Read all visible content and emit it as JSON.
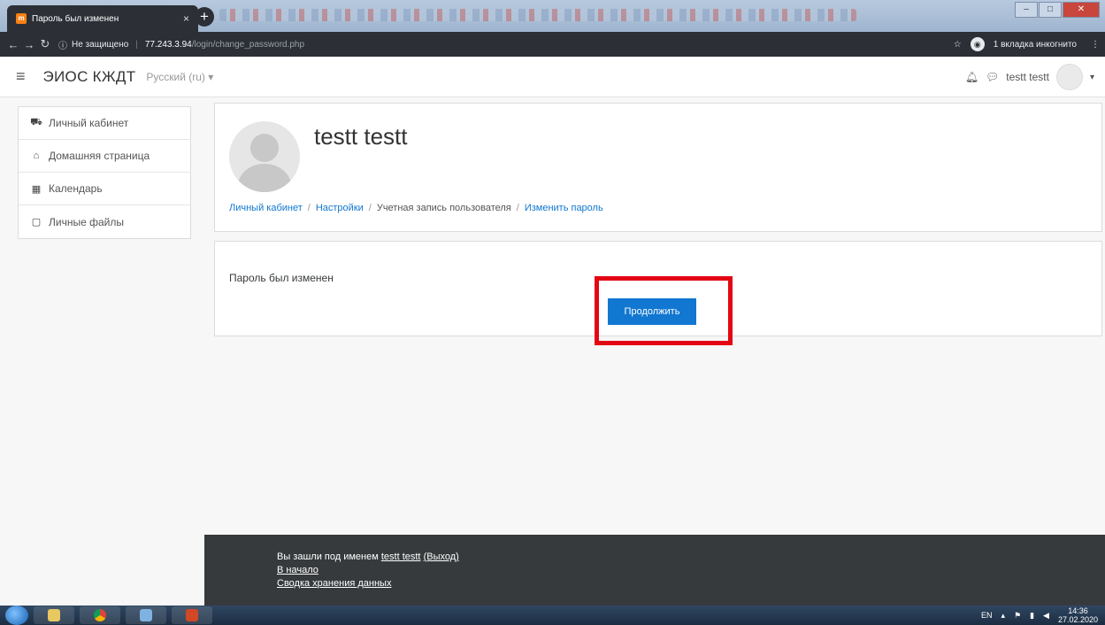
{
  "browser": {
    "tab_title": "Пароль был изменен",
    "tab_close": "×",
    "new_tab": "+",
    "not_secure": "Не защищено",
    "url_host": "77.243.3.94",
    "url_path": "/login/change_password.php",
    "incognito_label": "1 вкладка инкогнито",
    "menu_dots": "⋮",
    "star": "☆"
  },
  "navbar": {
    "brand": "ЭИОС КЖДТ",
    "language": "Русский (ru) ▾",
    "user_name": "testt testt",
    "user_caret": "▾"
  },
  "drawer": {
    "items": [
      {
        "label": "Личный кабинет",
        "icon": "dashboard-icon",
        "glyph": "⛟"
      },
      {
        "label": "Домашняя страница",
        "icon": "home-icon",
        "glyph": "⌂"
      },
      {
        "label": "Календарь",
        "icon": "calendar-icon",
        "glyph": "▦"
      },
      {
        "label": "Личные файлы",
        "icon": "file-icon",
        "glyph": "▢"
      }
    ]
  },
  "header": {
    "user_fullname": "testt testt",
    "breadcrumb": [
      "Личный кабинет",
      "Настройки",
      "Учетная запись пользователя",
      "Изменить пароль"
    ],
    "breadcrumb_sep": "/"
  },
  "message": {
    "text": "Пароль был изменен",
    "continue_label": "Продолжить"
  },
  "footer": {
    "logged_in_prefix": "Вы зашли под именем",
    "logged_in_user": "testt testt",
    "logout": "(Выход)",
    "home_link": "В начало",
    "data_retention": "Сводка хранения данных"
  },
  "taskbar": {
    "lang": "EN",
    "time": "14:36",
    "date": "27.02.2020"
  },
  "colors": {
    "link": "#1177d1",
    "button": "#1177d1",
    "highlight": "#e30613",
    "footer_bg": "#373a3c"
  }
}
